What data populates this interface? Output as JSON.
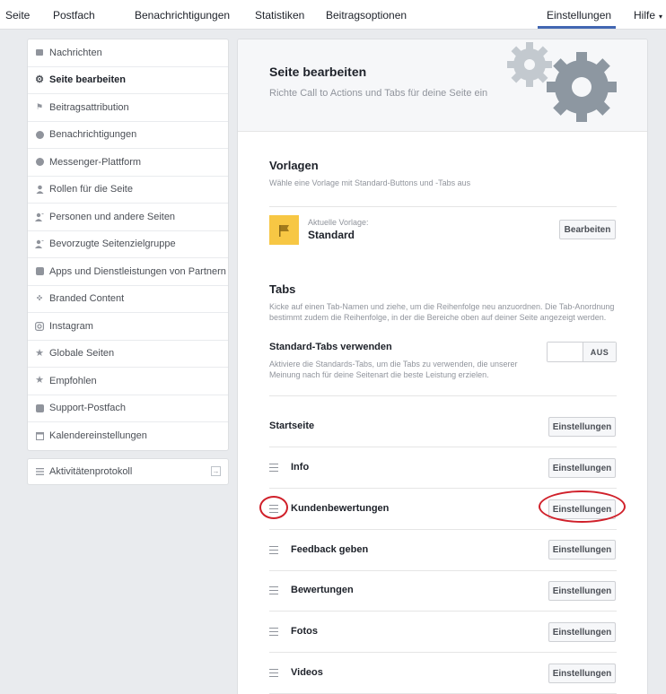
{
  "topnav": {
    "items": [
      "Seite",
      "Postfach",
      "Benachrichtigungen",
      "Statistiken",
      "Beitragsoptionen",
      "Einstellungen",
      "Hilfe"
    ],
    "active": "Einstellungen",
    "help_caret": "▾"
  },
  "sidebar": {
    "items": [
      {
        "label": "Nachrichten",
        "icon": "message-icon"
      },
      {
        "label": "Seite bearbeiten",
        "icon": "gear-icon",
        "active": true
      },
      {
        "label": "Beitragsattribution",
        "icon": "flag-icon"
      },
      {
        "label": "Benachrichtigungen",
        "icon": "globe-icon"
      },
      {
        "label": "Messenger-Plattform",
        "icon": "messenger-icon"
      },
      {
        "label": "Rollen für die Seite",
        "icon": "person-icon"
      },
      {
        "label": "Personen und andere Seiten",
        "icon": "person-add-icon"
      },
      {
        "label": "Bevorzugte Seitenzielgruppe",
        "icon": "person-add-icon"
      },
      {
        "label": "Apps und Dienstleistungen von Partnern",
        "icon": "cube-icon"
      },
      {
        "label": "Branded Content",
        "icon": "handshake-icon"
      },
      {
        "label": "Instagram",
        "icon": "instagram-icon"
      },
      {
        "label": "Globale Seiten",
        "icon": "star-icon"
      },
      {
        "label": "Empfohlen",
        "icon": "star-icon"
      },
      {
        "label": "Support-Postfach",
        "icon": "facebook-icon"
      },
      {
        "label": "Kalendereinstellungen",
        "icon": "calendar-icon"
      }
    ],
    "activity_log": "Aktivitätenprotokoll"
  },
  "header": {
    "title": "Seite bearbeiten",
    "subtitle": "Richte Call to Actions und Tabs für deine Seite ein"
  },
  "templates": {
    "title": "Vorlagen",
    "description": "Wähle eine Vorlage mit Standard-Buttons und -Tabs aus",
    "current_label": "Aktuelle Vorlage:",
    "current_value": "Standard",
    "edit_button": "Bearbeiten"
  },
  "tabs": {
    "title": "Tabs",
    "description_line1": "Kicke auf einen Tab-Namen und ziehe, um die Reihenfolge neu anzuordnen. Die Tab-Anordnung",
    "description_line2": "bestimmt zudem die Reihenfolge, in der die Bereiche oben auf deiner Seite angezeigt werden.",
    "standard_title": "Standard-Tabs verwenden",
    "standard_desc_line1": "Aktiviere die Standards-Tabs, um die Tabs zu verwenden, die unserer",
    "standard_desc_line2": "Meinung nach für deine Seitenart die beste Leistung erzielen.",
    "toggle_state": "AUS",
    "settings_label": "Einstellungen",
    "rows": [
      "Startseite",
      "Info",
      "Kundenbewertungen",
      "Feedback geben",
      "Bewertungen",
      "Fotos",
      "Videos"
    ]
  },
  "colors": {
    "accent": "#4267b2",
    "template_icon": "#f7c744",
    "annotation": "#d0202a",
    "gear": "#8d97a1",
    "gear_light": "#c3c9cf"
  }
}
